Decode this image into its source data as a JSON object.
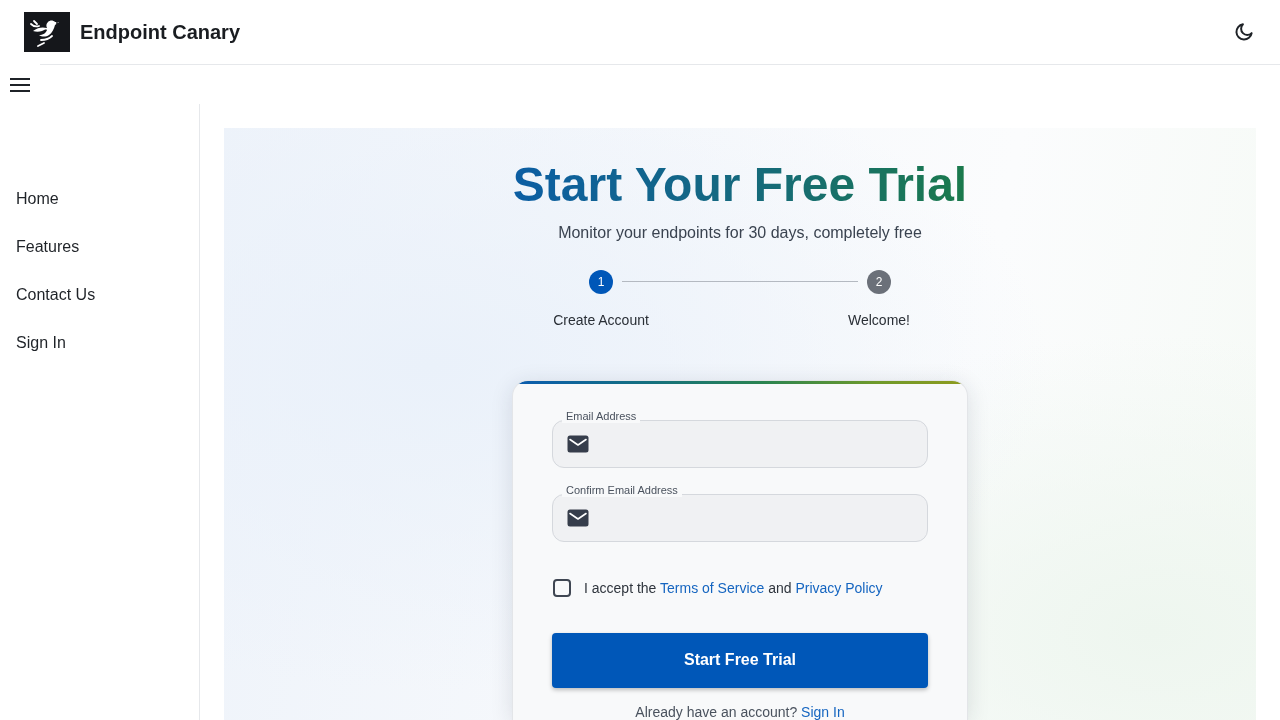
{
  "header": {
    "brand": "Endpoint Canary"
  },
  "sidebar": {
    "items": [
      {
        "label": "Home"
      },
      {
        "label": "Features"
      },
      {
        "label": "Contact Us"
      },
      {
        "label": "Sign In"
      }
    ]
  },
  "hero": {
    "title": "Start Your Free Trial",
    "subtitle": "Monitor your endpoints for 30 days, completely free"
  },
  "stepper": {
    "steps": [
      {
        "number": "1",
        "label": "Create Account",
        "selected": true
      },
      {
        "number": "2",
        "label": "Welcome!",
        "selected": false
      }
    ]
  },
  "form": {
    "fields": [
      {
        "label": "Email Address"
      },
      {
        "label": "Confirm Email Address"
      }
    ],
    "terms": {
      "checked": false,
      "parts": [
        {
          "kind": "text",
          "text": "I accept the"
        },
        {
          "kind": "link",
          "text": "Terms of Service"
        },
        {
          "kind": "text",
          "text": "and"
        },
        {
          "kind": "link",
          "text": "Privacy Policy"
        }
      ]
    },
    "submit": "Start Free Trial",
    "signin_prompt": {
      "parts": [
        {
          "kind": "text",
          "text": "Already have an account?"
        },
        {
          "kind": "link",
          "text": "Sign In"
        }
      ]
    }
  }
}
